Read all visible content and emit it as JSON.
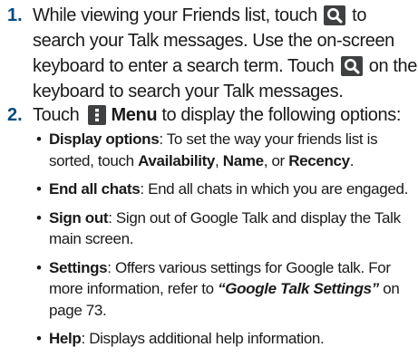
{
  "steps": [
    {
      "number": "1.",
      "lines": {
        "a": "While viewing your Friends list, touch",
        "b": "to search your Talk messages. Use the on-screen keyboard to enter a search term. Touch",
        "c": "on the keyboard to search your Talk messages."
      },
      "icons": [
        "search-icon",
        "search-icon"
      ]
    },
    {
      "number": "2.",
      "lines": {
        "a": "Touch",
        "menu_label": "Menu",
        "b": "to display the following options:"
      },
      "icons": [
        "menu-icon"
      ]
    }
  ],
  "options": [
    {
      "term": "Display options",
      "text_before": ": To set the way your friends list is sorted, touch ",
      "choices": [
        "Availability",
        "Name",
        "Recency"
      ],
      "sep1": ", ",
      "sep2": ", or ",
      "end": "."
    },
    {
      "term": "End all chats",
      "text": ": End all chats in which you are engaged."
    },
    {
      "term": "Sign out",
      "text": ": Sign out of Google Talk and display the Talk main screen."
    },
    {
      "term": "Settings",
      "text_before": ": Offers various settings for Google talk. For more information, refer to ",
      "reference": "“Google Talk Settings”",
      "text_after": " on page 73."
    },
    {
      "term": "Help",
      "text": ": Displays additional help information."
    }
  ],
  "colors": {
    "step_number": "#004a7f",
    "icon_bg": "#3e4041",
    "icon_fg": "#ffffff"
  }
}
